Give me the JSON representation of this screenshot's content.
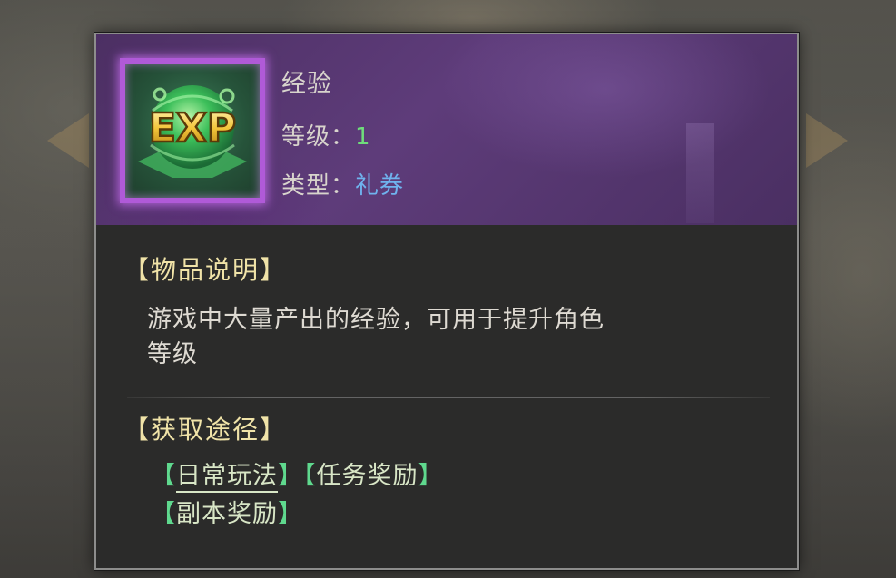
{
  "item": {
    "name": "经验",
    "level_label": "等级：",
    "level_value": "1",
    "type_label": "类型：",
    "type_value": "礼券",
    "icon_text": "EXP",
    "icon": "exp-orb-icon"
  },
  "description": {
    "title": "【物品说明】",
    "text_line1": "游戏中大量产出的经验，可用于提升角色",
    "text_line2": "等级"
  },
  "sources": {
    "title": "【获取途径】",
    "bracket_open": "【",
    "bracket_close": "】",
    "items": [
      {
        "label": "日常玩法"
      },
      {
        "label": "任务奖励"
      },
      {
        "label": "副本奖励"
      }
    ]
  },
  "colors": {
    "rarity_frame": "#b05ad8",
    "header_bg": "#5e3c7a",
    "level_value": "#6fdc7b",
    "type_value": "#6fb3ee",
    "section_title": "#f0e3a8",
    "source_bracket": "#5fd98e"
  }
}
